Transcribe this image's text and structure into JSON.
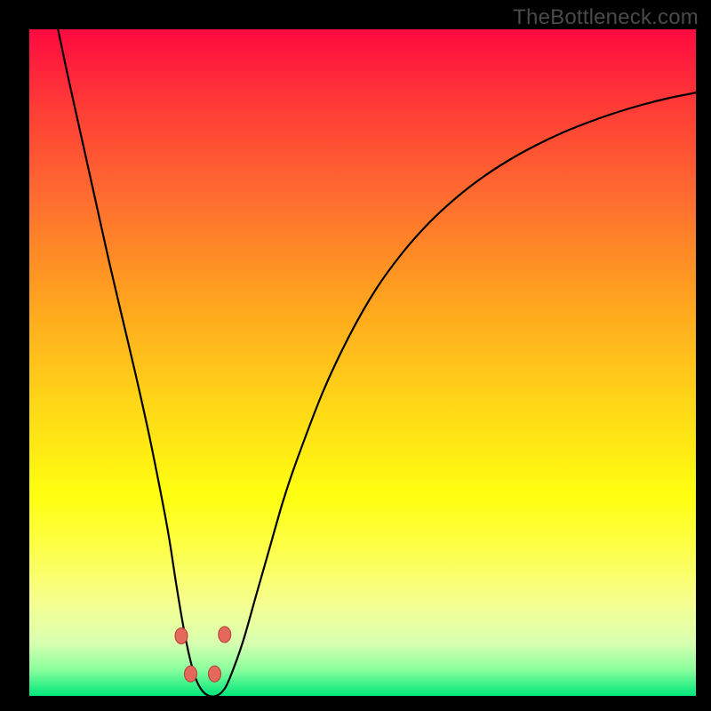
{
  "watermark": {
    "text": "TheBottleneck.com"
  },
  "chart_data": {
    "type": "line",
    "title": "",
    "xlabel": "",
    "ylabel": "",
    "xlim": [
      0,
      100
    ],
    "ylim": [
      0,
      100
    ],
    "grid": false,
    "legend": false,
    "series": [
      {
        "name": "curve",
        "x": [
          4.3,
          6,
          8,
          10,
          12,
          14,
          16,
          18,
          20,
          21,
          22,
          23,
          24,
          25,
          26,
          27,
          28,
          29,
          30,
          32,
          34,
          36,
          38,
          40,
          44,
          48,
          52,
          56,
          60,
          64,
          68,
          72,
          76,
          80,
          84,
          88,
          92,
          96,
          100
        ],
        "y": [
          100,
          92,
          83,
          74,
          65,
          56.5,
          48,
          39,
          29,
          23.5,
          17,
          11,
          6,
          2.5,
          0.7,
          0,
          0,
          0.7,
          2.5,
          8,
          15,
          22,
          29,
          35,
          45.5,
          54,
          61,
          66.5,
          71,
          74.7,
          77.8,
          80.4,
          82.6,
          84.5,
          86.1,
          87.5,
          88.7,
          89.7,
          90.5
        ]
      }
    ],
    "markers": [
      {
        "x": 22.8,
        "y": 9.0
      },
      {
        "x": 24.2,
        "y": 3.3
      },
      {
        "x": 27.8,
        "y": 3.3
      },
      {
        "x": 29.3,
        "y": 9.2
      }
    ],
    "marker_style": {
      "fill": "#e4695c",
      "stroke": "#b23d34",
      "rx": 7,
      "ry": 9
    }
  }
}
